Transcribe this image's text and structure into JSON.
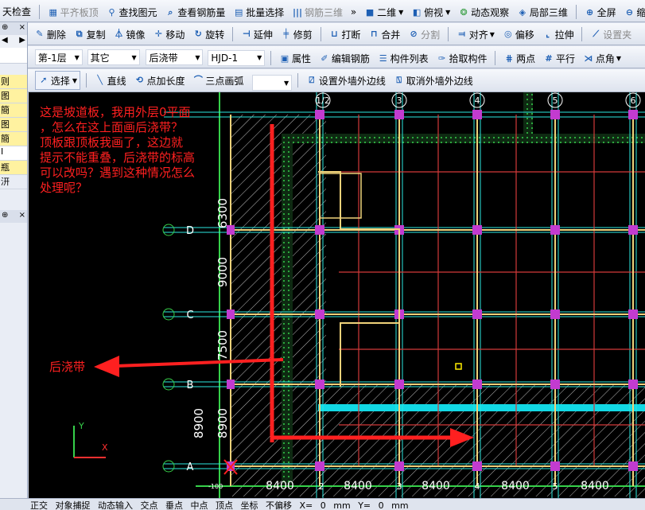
{
  "toolbar1": {
    "items": [
      "天检查",
      "平齐板顶",
      "查找图元",
      "查看钢筋量",
      "批量选择",
      "钢筋三维",
      "»",
      "二维",
      "俯视",
      "动态观察",
      "局部三维",
      "全屏",
      "缩"
    ]
  },
  "toolbar2": {
    "items": [
      "删除",
      "复制",
      "镜像",
      "移动",
      "旋转",
      "延伸",
      "修剪",
      "打断",
      "合并",
      "分割",
      "对齐",
      "偏移",
      "拉伸",
      "设置夹"
    ]
  },
  "toolbar3": {
    "floor": "第-1层",
    "category": "其它",
    "type": "后浇带",
    "name": "HJD-1",
    "items": [
      "属性",
      "编辑钢筋",
      "构件列表",
      "拾取构件",
      "两点",
      "平行",
      "点角"
    ]
  },
  "toolbar4": {
    "select": "选择",
    "items": [
      "直线",
      "点加长度",
      "三点画弧",
      "设置外墙外边线",
      "取消外墙外边线"
    ]
  },
  "left_panel": {
    "header_pin": "⊕",
    "header_close": "×",
    "items": [
      "则",
      "图",
      "簡",
      "图",
      "簡",
      "I",
      "瓶",
      "汧"
    ]
  },
  "annotation": {
    "main_text": [
      "这是坡道板，我用外层0平面",
      "，怎么在这上面画后浇带？",
      "顶板跟顶板我画了，这边就",
      "提示不能重叠，后浇带的标高",
      "可以改吗？遇到这种情况怎么",
      "处理呢？"
    ],
    "label": "后浇带"
  },
  "drawing": {
    "grid_top": [
      "1/2",
      "3",
      "4",
      "5",
      "6"
    ],
    "grid_bottom": [
      "2",
      "3",
      "4",
      "5"
    ],
    "dims_bottom": [
      "8400",
      "8400",
      "8400",
      "8400",
      "8400"
    ],
    "rows_left": [
      "D",
      "C",
      "B",
      "A"
    ],
    "dims_left": [
      "6300",
      "9000",
      "7500",
      "8900"
    ],
    "small_left": [
      "-100"
    ]
  },
  "status": {
    "items": [
      "正交",
      "对象捕捉",
      "动态输入",
      "交点",
      "垂点",
      "中点",
      "顶点",
      "坐标",
      "不偏移",
      "X=",
      "0",
      "mm",
      "Y=",
      "0",
      "mm"
    ]
  },
  "colors": {
    "canvas_bg": "#000000",
    "beam": "#f0d27a",
    "column": "#c23bd0",
    "grid": "#2be8e0",
    "wall": "#36d04a",
    "annotation": "#ff2020"
  }
}
